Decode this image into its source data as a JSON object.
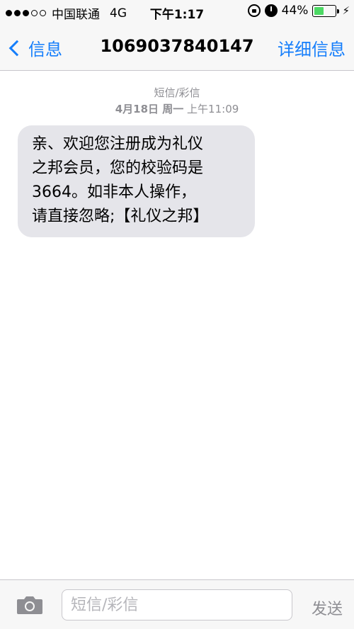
{
  "status_bar": {
    "signal_filled": 3,
    "signal_total": 5,
    "carrier": "中国联通",
    "network": "4G",
    "time": "下午1:17",
    "battery_percent": "44%",
    "battery_level": 0.44,
    "battery_color": "#4cd964"
  },
  "nav": {
    "back_label": "信息",
    "title": "1069037840147",
    "details_label": "详细信息",
    "accent_color": "#157efb"
  },
  "thread": {
    "message_type": "短信/彩信",
    "date": "4月18日 周一",
    "time": "上午11:09",
    "messages": [
      {
        "direction": "incoming",
        "lines": [
          "亲、欢迎您注册成为礼仪",
          "之邦会员，您的校验码是",
          "3664。如非本人操作，",
          "请直接忽略;【礼仪之邦】"
        ]
      }
    ]
  },
  "composer": {
    "placeholder": "短信/彩信",
    "send_label": "发送",
    "camera_icon": "camera-icon"
  }
}
